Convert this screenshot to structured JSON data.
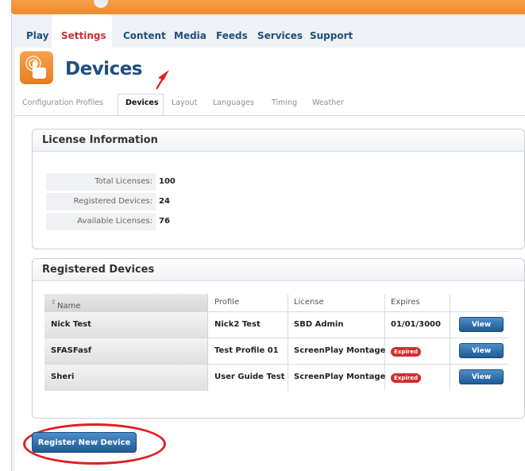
{
  "colors": {
    "accent_orange": "#f08a2c",
    "nav_blue": "#1e4f7d",
    "active_red": "#cc2e2e",
    "expired_red": "#d62b2b",
    "annotation_red": "#e01e1e"
  },
  "main_nav": [
    {
      "label": "Play",
      "active": false
    },
    {
      "label": "Settings",
      "active": true
    },
    {
      "label": "Content",
      "active": false
    },
    {
      "label": "Media",
      "active": false
    },
    {
      "label": "Feeds",
      "active": false
    },
    {
      "label": "Services",
      "active": false
    },
    {
      "label": "Support",
      "active": false
    }
  ],
  "page": {
    "title": "Devices",
    "icon": "touch-hand-icon"
  },
  "sub_tabs": [
    {
      "label": "Configuration Profiles",
      "active": false
    },
    {
      "label": "Devices",
      "active": true
    },
    {
      "label": "Layout",
      "active": false
    },
    {
      "label": "Languages",
      "active": false
    },
    {
      "label": "Timing",
      "active": false
    },
    {
      "label": "Weather",
      "active": false
    }
  ],
  "license_info": {
    "title": "License Information",
    "rows": [
      {
        "label": "Total Licenses:",
        "value": "100"
      },
      {
        "label": "Registered Devices:",
        "value": "24"
      },
      {
        "label": "Available Licenses:",
        "value": "76"
      }
    ]
  },
  "registered_devices": {
    "title": "Registered Devices",
    "columns": [
      "Name",
      "Profile",
      "License",
      "Expires"
    ],
    "sort_indicator": "⇕",
    "rows": [
      {
        "name": "Nick Test",
        "profile": "Nick2 Test",
        "license": "SBD Admin",
        "expires": "01/01/3000",
        "expired": false,
        "action": "View"
      },
      {
        "name": "SFASFasf",
        "profile": "Test Profile 01",
        "license": "ScreenPlay Montage",
        "expires": "Expired",
        "expired": true,
        "action": "View"
      },
      {
        "name": "Sheri",
        "profile": "User Guide Test",
        "license": "ScreenPlay Montage",
        "expires": "Expired",
        "expired": true,
        "action": "View"
      }
    ]
  },
  "register_button": {
    "label": "Register New Device"
  }
}
